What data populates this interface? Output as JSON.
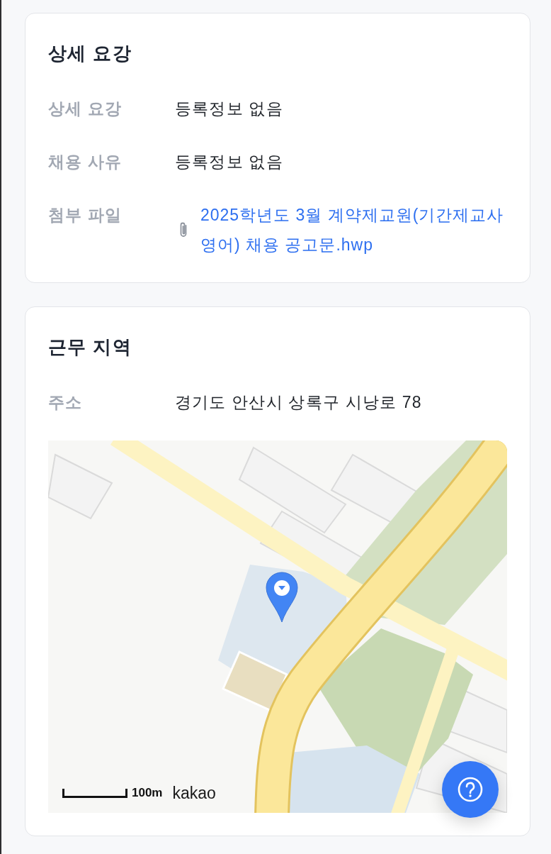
{
  "sections": [
    {
      "title": "상세 요강",
      "rows": [
        {
          "label": "상세 요강",
          "kind": "text",
          "value": "등록정보 없음"
        },
        {
          "label": "채용 사유",
          "kind": "text",
          "value": "등록정보 없음"
        },
        {
          "label": "첨부 파일",
          "kind": "file",
          "value": "2025학년도 3월 계약제교원(기간제교사 영어) 채용 공고문.hwp"
        }
      ]
    },
    {
      "title": "근무 지역",
      "rows": [
        {
          "label": "주소",
          "kind": "text",
          "value": "경기도 안산시 상록구 시낭로 78"
        }
      ],
      "map": {
        "scale": "100m",
        "provider": "kakao"
      }
    }
  ]
}
